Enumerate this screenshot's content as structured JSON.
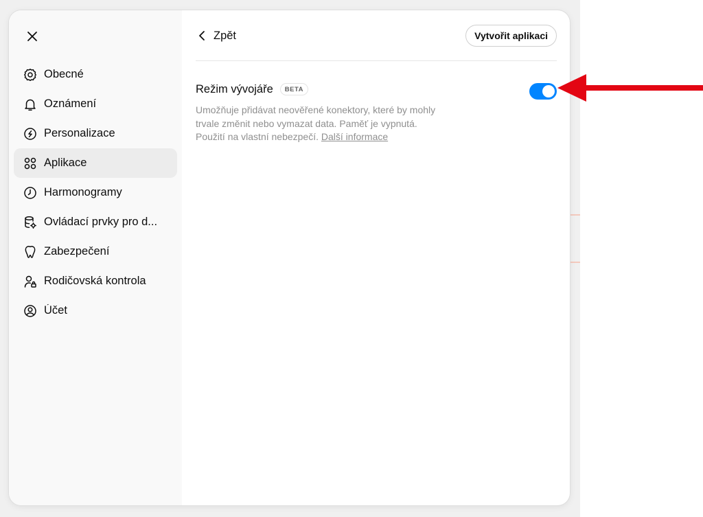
{
  "colors": {
    "accent": "#0285ff",
    "arrow": "#e30613",
    "sidebar_bg": "#f9f9f9",
    "active_item_bg": "#ececec"
  },
  "sidebar": {
    "close_icon": "close-icon",
    "items": [
      {
        "label": "Obecné",
        "icon": "gear-icon"
      },
      {
        "label": "Oznámení",
        "icon": "bell-icon"
      },
      {
        "label": "Personalizace",
        "icon": "personalization-icon"
      },
      {
        "label": "Aplikace",
        "icon": "apps-grid-icon",
        "active": true
      },
      {
        "label": "Harmonogramy",
        "icon": "clock-icon"
      },
      {
        "label": "Ovládací prvky pro d...",
        "icon": "database-gear-icon"
      },
      {
        "label": "Zabezpečení",
        "icon": "shield-icon"
      },
      {
        "label": "Rodičovská kontrola",
        "icon": "user-lock-icon"
      },
      {
        "label": "Účet",
        "icon": "account-icon"
      }
    ]
  },
  "header": {
    "back_label": "Zpět",
    "create_app_label": "Vytvořit aplikaci"
  },
  "developer_mode": {
    "title": "Režim vývojáře",
    "badge": "BETA",
    "description": "Umožňuje přidávat neověřené konektory, které by mohly trvale změnit nebo vymazat data. Paměť je vypnutá. Použití na vlastní nebezpečí.",
    "learn_more": "Další informace",
    "enabled": true
  }
}
